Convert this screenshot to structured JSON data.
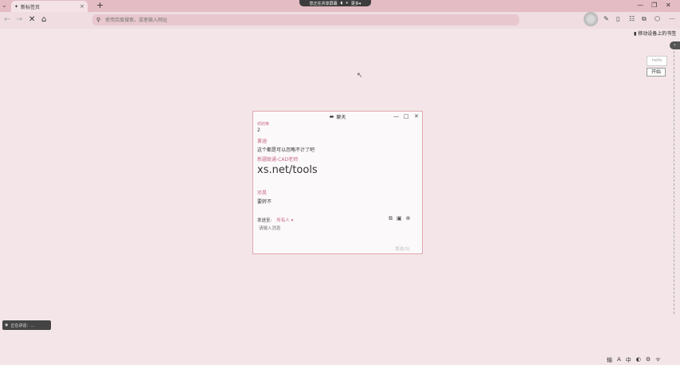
{
  "tabstrip": {
    "menu_icon": "tab-menu-chevron-icon",
    "tab_title": "新标签页",
    "tab_close": "×",
    "new_tab": "+"
  },
  "share_bar": {
    "label": "您正在共享屏幕",
    "mic": "◖",
    "pause": "⏸",
    "more": "更多▾"
  },
  "window_controls": {
    "minimize": "—",
    "restore": "❐",
    "close": "✕"
  },
  "toolbar": {
    "back": "←",
    "forward": "→",
    "stop": "✕",
    "home": "⌂",
    "url_placeholder": "使用百度搜索，或者输入网址",
    "icons": [
      "extension-icon",
      "sidebar-icon",
      "collections-icon",
      "extensions-icon",
      "downloads-icon",
      "menu-icon"
    ]
  },
  "bookmarks": {
    "label": "移动设备上的书签"
  },
  "side_widget": {
    "top": "hello",
    "button": "开始"
  },
  "chat": {
    "title": "聊天",
    "messages": {
      "m1_sender": "邓欣荣",
      "m1_text": "2",
      "m2_sender": "黄涵",
      "m2_text": "这个都是可以忽略不计了吧",
      "m3_sender": "新疆联通-CAD老师",
      "m3_text": "xs.net/tools",
      "m4_sender": "邓昊",
      "m4_text": "要转不"
    },
    "send_to_label": "发送至:",
    "send_to_value": "所有人 ▾",
    "input_placeholder": "请输入消息",
    "send_button": "发送(S)"
  },
  "bottom_left": {
    "label": "正在讲话：…"
  },
  "tray": {
    "items": [
      "输",
      "A",
      "中",
      "◐",
      "⚙",
      "ᯤ"
    ]
  },
  "colors": {
    "accent": "#c46a82",
    "background": "#f4e6e8",
    "tabstrip": "#e4bcc4"
  }
}
